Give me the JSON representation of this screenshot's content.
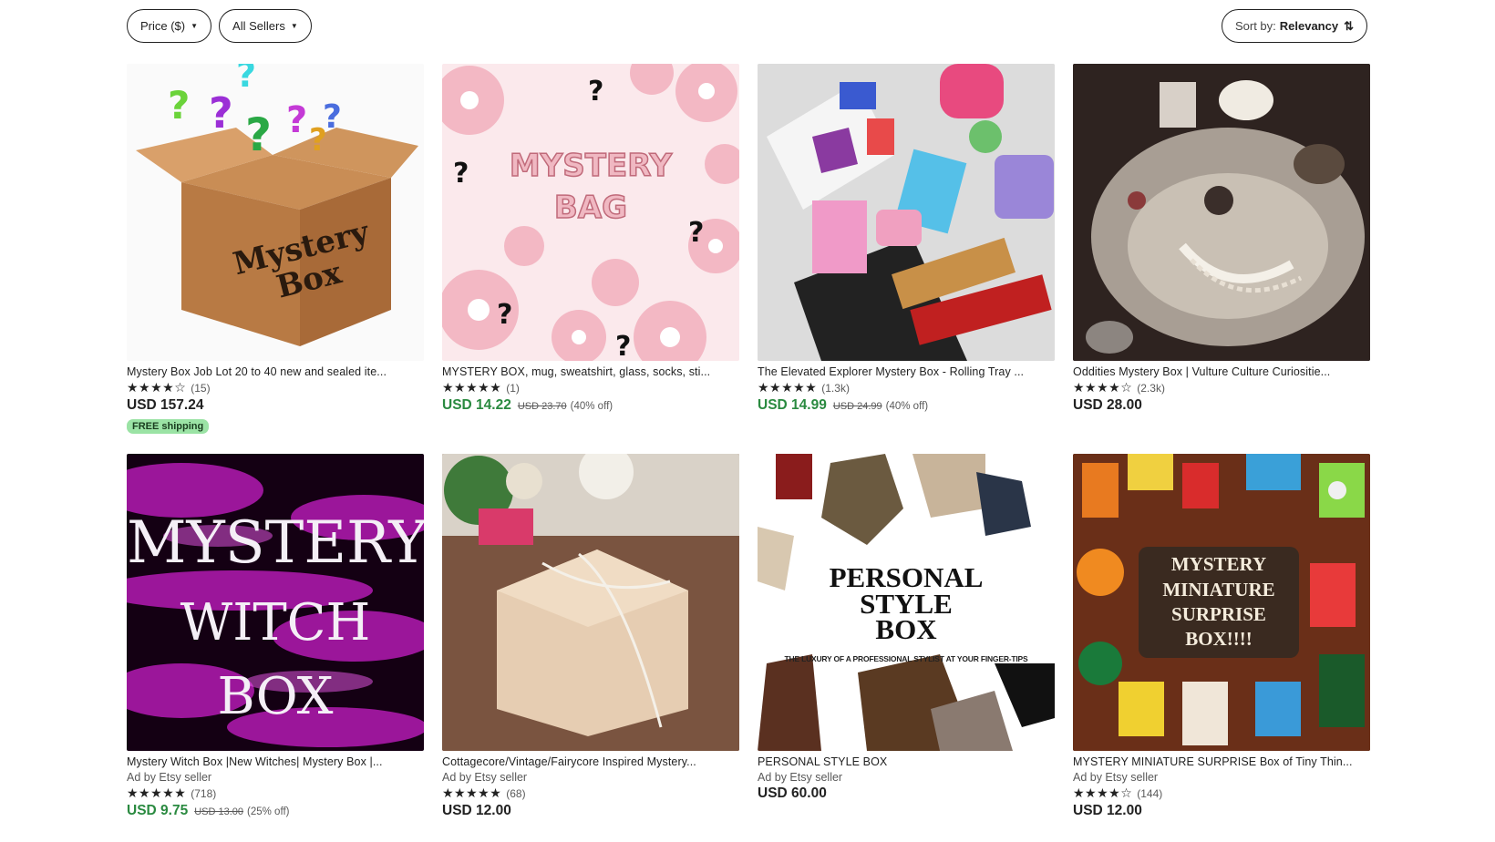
{
  "filters": {
    "price": "Price ($)",
    "sellers": "All Sellers"
  },
  "sort": {
    "prefix": "Sort by:",
    "value": "Relevancy"
  },
  "thumb_text": {
    "bag_line1": "MYSTERY",
    "bag_line2": "BAG",
    "box_line1": "Mystery",
    "box_line2": "Box",
    "witch_line1": "MYSTERY",
    "witch_line2": "WITCH BOX",
    "style_line1": "PERSONAL",
    "style_line2": "STYLE",
    "style_line3": "BOX",
    "style_sub": "THE LUXURY OF A PROFESSIONAL STYLIST AT YOUR FINGER-TIPS",
    "mini_line1": "MYSTERY",
    "mini_line2": "MINIATURE",
    "mini_line3": "SURPRISE",
    "mini_line4": "BOX!!!!"
  },
  "listings": [
    {
      "title": "Mystery Box Job Lot 20 to 40 new and sealed ite...",
      "stars": "★★★★☆",
      "count": "(15)",
      "price": "USD 157.24",
      "badge": "FREE shipping"
    },
    {
      "title": "MYSTERY BOX, mug, sweatshirt, glass, socks, sti...",
      "stars": "★★★★★",
      "count": "(1)",
      "price": "USD 14.22",
      "orig": "USD 23.70",
      "off": "(40% off)"
    },
    {
      "title": "The Elevated Explorer Mystery Box - Rolling Tray ...",
      "stars": "★★★★★",
      "count": "(1.3k)",
      "price": "USD 14.99",
      "orig": "USD 24.99",
      "off": "(40% off)"
    },
    {
      "title": "Oddities Mystery Box | Vulture Culture Curiositie...",
      "stars": "★★★★☆",
      "count": "(2.3k)",
      "price": "USD 28.00"
    },
    {
      "title": "Mystery Witch Box |New Witches| Mystery Box |...",
      "ad": "Ad by Etsy seller",
      "stars": "★★★★★",
      "count": "(718)",
      "price": "USD 9.75",
      "orig": "USD 13.00",
      "off": "(25% off)"
    },
    {
      "title": "Cottagecore/Vintage/Fairycore Inspired Mystery...",
      "ad": "Ad by Etsy seller",
      "stars": "★★★★★",
      "count": "(68)",
      "price": "USD 12.00"
    },
    {
      "title": "PERSONAL STYLE BOX",
      "ad": "Ad by Etsy seller",
      "price": "USD 60.00"
    },
    {
      "title": "MYSTERY MINIATURE SURPRISE Box of Tiny Thin...",
      "ad": "Ad by Etsy seller",
      "stars": "★★★★☆",
      "count": "(144)",
      "price": "USD 12.00"
    }
  ]
}
